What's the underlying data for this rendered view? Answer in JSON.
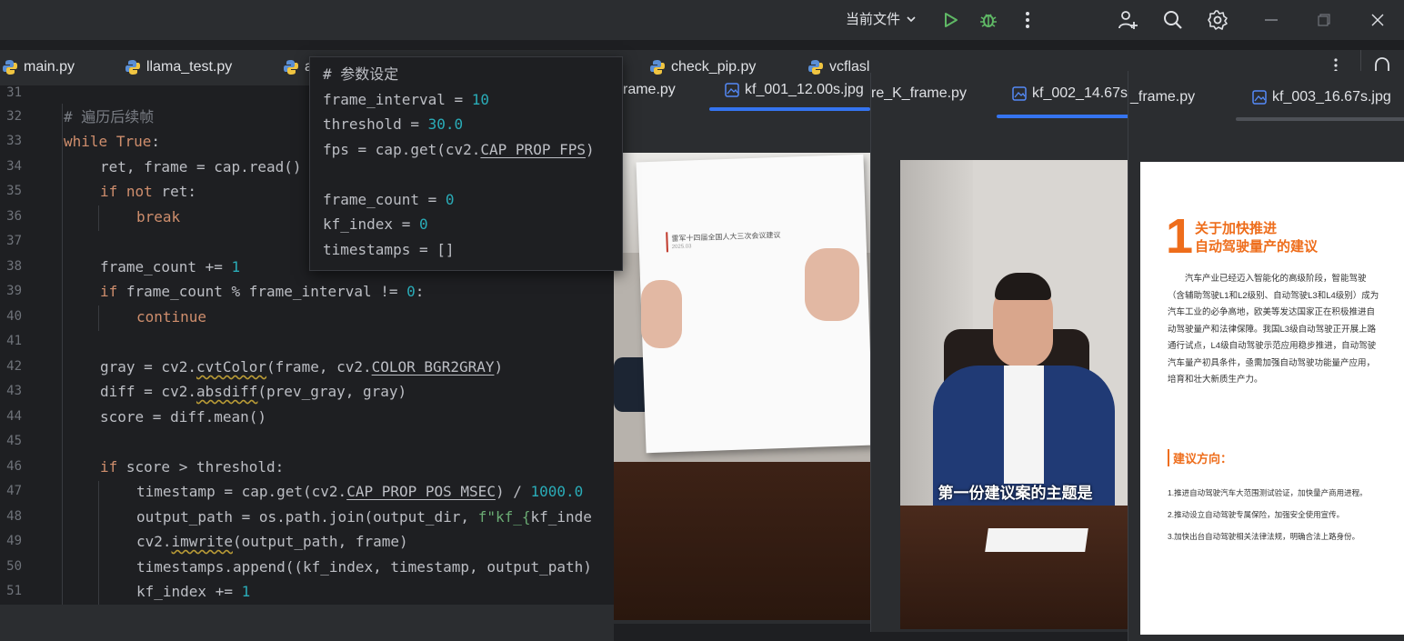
{
  "titlebar": {
    "run_config_label": "当前文件",
    "icons": [
      "run-icon",
      "debug-icon",
      "more-icon",
      "add-user-icon",
      "search-icon",
      "settings-icon"
    ],
    "window_controls": [
      "minimize-icon",
      "restore-icon",
      "close-icon"
    ]
  },
  "editor_tabs": [
    {
      "label": "main.py"
    },
    {
      "label": "llama_test.py"
    },
    {
      "label": "a"
    },
    {
      "label": "check_pip.py"
    },
    {
      "label": "vcflasl"
    }
  ],
  "code_lines": [
    {
      "num": "31"
    },
    {
      "num": "32"
    },
    {
      "num": "33"
    },
    {
      "num": "34"
    },
    {
      "num": "35"
    },
    {
      "num": "36"
    },
    {
      "num": "37"
    },
    {
      "num": "38"
    },
    {
      "num": "39"
    },
    {
      "num": "40"
    },
    {
      "num": "41"
    },
    {
      "num": "42"
    },
    {
      "num": "43"
    },
    {
      "num": "44"
    },
    {
      "num": "45"
    },
    {
      "num": "46"
    },
    {
      "num": "47"
    },
    {
      "num": "48"
    },
    {
      "num": "49"
    },
    {
      "num": "50"
    },
    {
      "num": "51"
    }
  ],
  "code": {
    "l32": "# 遍历后续帧",
    "l33_kw": "while",
    "l33_kw2": "True",
    "l34": "ret, frame = cap.read()",
    "l35_kw": "if not",
    "l35_rest": " ret:",
    "l36": "break",
    "l38_a": "frame_count += ",
    "l38_n": "1",
    "l39_kw": "if",
    "l39_a": " frame_count % frame_interval != ",
    "l39_n": "0",
    "l40": "continue",
    "l42_a": "gray = cv2.",
    "l42_f": "cvtColor",
    "l42_b": "(frame, cv2.",
    "l42_c": "COLOR_BGR2GRAY",
    "l43_a": "diff = cv2.",
    "l43_f": "absdiff",
    "l43_b": "(prev_gray, gray)",
    "l44": "score = diff.mean()",
    "l46_kw": "if",
    "l46_rest": " score > threshold:",
    "l47_a": "timestamp = cap.get(cv2.",
    "l47_c": "CAP_PROP_POS_MSEC",
    "l47_b": ") / ",
    "l47_n": "1000.0",
    "l48_a": "output_path = os.path.join(output_dir, ",
    "l48_s": "f\"kf_{",
    "l48_b": "kf_inde",
    "l49_a": "cv2.",
    "l49_f": "imwrite",
    "l49_b": "(output_path, frame)",
    "l50": "timestamps.append((kf_index, timestamp, output_path)",
    "l51_a": "kf_index += ",
    "l51_n": "1"
  },
  "popup": {
    "comment": "# 参数设定",
    "l1_a": "frame_interval = ",
    "l1_n": "10",
    "l2_a": "threshold = ",
    "l2_n": "30.0",
    "l3_a": "fps = cap.get(cv2.",
    "l3_c": "CAP_PROP_FPS",
    "l3_b": ")",
    "l4_a": "frame_count = ",
    "l4_n": "0",
    "l5_a": "kf_index = ",
    "l5_n": "0",
    "l6": "timestamps = []"
  },
  "image_windows": [
    {
      "partial_tab": "rame.py",
      "active_tab": "kf_001_12.00s.jpg"
    },
    {
      "partial_tab": "re_K_frame.py",
      "active_tab": "kf_002_14.67s."
    },
    {
      "partial_tab": "_frame.py",
      "active_tab": "kf_003_16.67s.jpg"
    }
  ],
  "photo1": {
    "paper_title": "雷军十四届全国人大三次会议建议",
    "paper_date": "2025.03"
  },
  "photo2": {
    "subtitle": "第一份建议案的主题是"
  },
  "doc": {
    "number": "1",
    "title_line1": "关于加快推进",
    "title_line2": "自动驾驶量产的建议",
    "para": "汽车产业已经迈入智能化的高级阶段，智能驾驶（含辅助驾驶L1和L2级别、自动驾驶L3和L4级别）成为汽车工业的必争高地，欧美等发达国家正在积极推进自动驾驶量产和法律保障。我国L3级自动驾驶正开展上路通行试点，L4级自动驾驶示范应用稳步推进，自动驾驶汽车量产初具条件，亟需加强自动驾驶功能量产应用，培育和壮大新质生产力。",
    "section": "建议方向：",
    "item1": "1.推进自动驾驶汽车大范围测试验证，加快量产商用进程。",
    "item2": "2.推动设立自动驾驶专属保险，加强安全使用宣传。",
    "item3": "3.加快出台自动驾驶相关法律法规，明确合法上路身份。"
  },
  "colors": {
    "ide_bg": "#1e1f22",
    "panel_bg": "#2b2d30",
    "keyword": "#cf8e6d",
    "number": "#2aacb8",
    "string": "#6aab73",
    "accent_blue": "#3574f0",
    "doc_orange": "#ee6d1b"
  }
}
